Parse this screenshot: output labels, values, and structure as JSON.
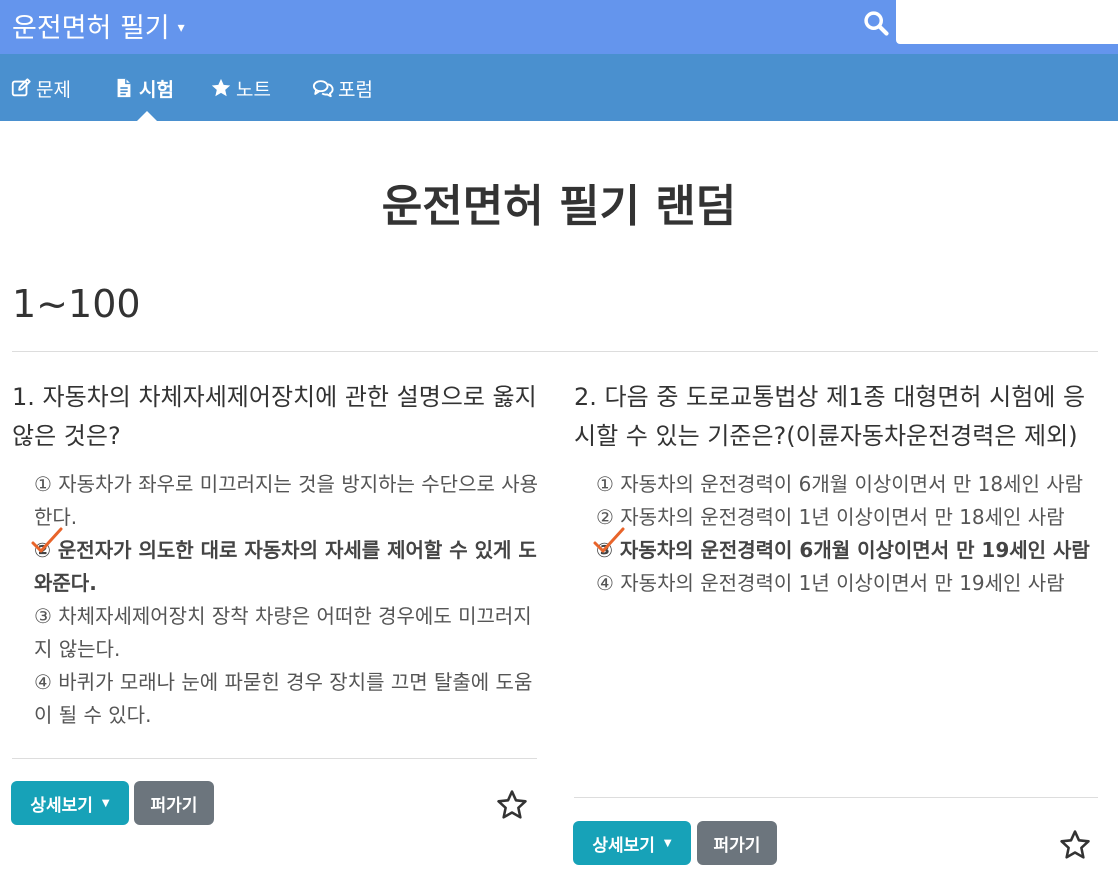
{
  "header": {
    "app_title": "운전면허 필기",
    "caret": "▾",
    "search_placeholder": ""
  },
  "nav": {
    "tabs": [
      {
        "label": "문제",
        "icon": "edit-icon"
      },
      {
        "label": "시험",
        "icon": "file-icon",
        "active": true
      },
      {
        "label": "노트",
        "icon": "star-icon"
      },
      {
        "label": "포럼",
        "icon": "comments-icon"
      }
    ]
  },
  "page": {
    "title": "운전면허 필기 랜덤",
    "range": "1~100"
  },
  "questions": [
    {
      "text": "1. 자동차의 차체자세제어장치에 관한 설명으로 옳지 않은 것은?",
      "options": [
        "① 자동차가 좌우로 미끄러지는 것을 방지하는 수단으로 사용한다.",
        "② 운전자가 의도한 대로 자동차의 자세를 제어할 수 있게 도와준다.",
        "③ 차체자세제어장치 장착 차량은 어떠한 경우에도 미끄러지지 않는다.",
        "④ 바퀴가 모래나 눈에 파묻힌 경우 장치를 끄면 탈출에 도움이 될 수 있다."
      ],
      "correct_index": 1,
      "detail_label": "상세보기",
      "share_label": "퍼가기"
    },
    {
      "text": "2. 다음 중 도로교통법상 제1종 대형면허 시험에 응시할 수 있는 기준은?(이륜자동차운전경력은 제외)",
      "options": [
        "① 자동차의 운전경력이 6개월 이상이면서 만 18세인 사람",
        "② 자동차의 운전경력이 1년 이상이면서 만 18세인 사람",
        "③ 자동차의 운전경력이 6개월 이상이면서 만 19세인 사람",
        "④ 자동차의 운전경력이 1년 이상이면서 만 19세인 사람"
      ],
      "correct_index": 2,
      "detail_label": "상세보기",
      "share_label": "퍼가기"
    }
  ],
  "colors": {
    "topbar": "#6495ed",
    "navbar": "#4a90cf",
    "detail_button": "#17a2b8",
    "share_button": "#6c757d",
    "check_mark": "#e8642a"
  }
}
